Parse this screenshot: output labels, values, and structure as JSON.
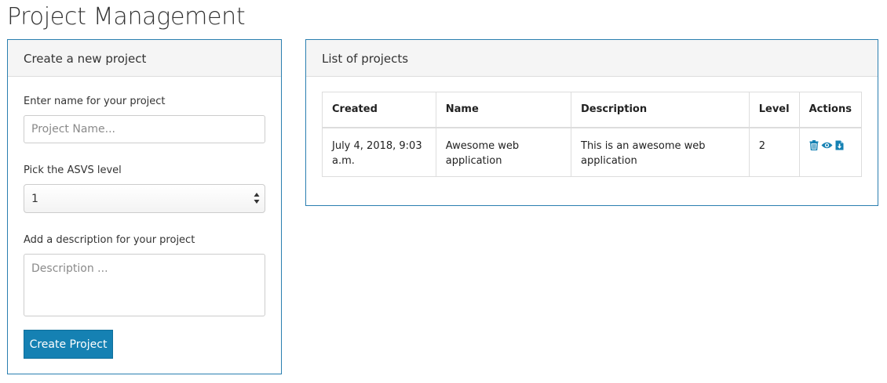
{
  "page": {
    "title": "Project Management"
  },
  "create_panel": {
    "heading": "Create a new project",
    "name_label": "Enter name for your project",
    "name_placeholder": "Project Name...",
    "name_value": "",
    "level_label": "Pick the ASVS level",
    "level_value": "1",
    "description_label": "Add a description for your project",
    "description_placeholder": "Description ...",
    "description_value": "",
    "submit_label": "Create Project"
  },
  "list_panel": {
    "heading": "List of projects",
    "columns": [
      "Created",
      "Name",
      "Description",
      "Level",
      "Actions"
    ],
    "rows": [
      {
        "created": "July 4, 2018, 9:03 a.m.",
        "name": "Awesome web application",
        "description": "This is an awesome web application",
        "level": "2",
        "actions": [
          "trash-icon",
          "eye-icon",
          "download-file-icon"
        ]
      }
    ]
  },
  "colors": {
    "accent": "#1581b3",
    "panel_border": "#2a7fb0",
    "panel_heading_bg": "#f5f5f5"
  }
}
